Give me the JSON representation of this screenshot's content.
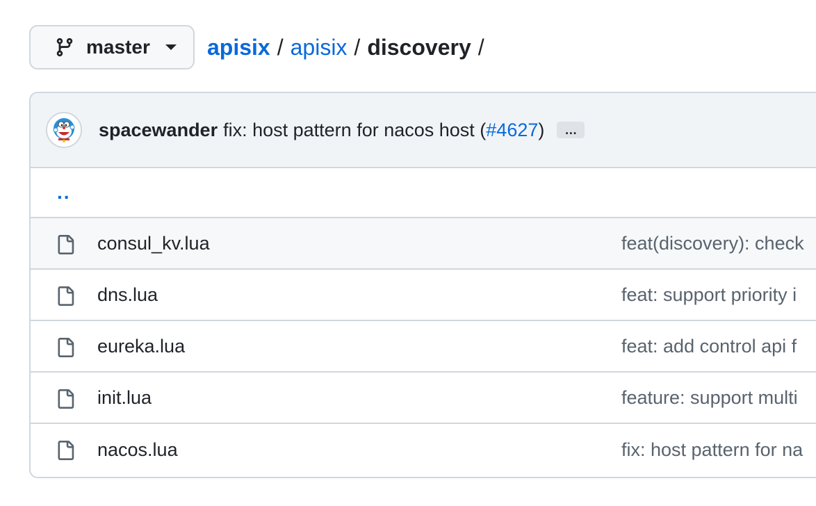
{
  "branch": {
    "name": "master",
    "icon": "git-branch-icon"
  },
  "breadcrumb": {
    "owner": "apisix",
    "repo": "apisix",
    "current": "discovery",
    "separator": "/"
  },
  "latest_commit": {
    "author": "spacewander",
    "message_prefix": "fix: host pattern for nacos host (",
    "pr": "#4627",
    "message_suffix": ")",
    "ellipsis": "…"
  },
  "parent_dir": "..",
  "files": [
    {
      "name": "consul_kv.lua",
      "commit": "feat(discovery): check"
    },
    {
      "name": "dns.lua",
      "commit": "feat: support priority i"
    },
    {
      "name": "eureka.lua",
      "commit": "feat: add control api f"
    },
    {
      "name": "init.lua",
      "commit": "feature: support multi"
    },
    {
      "name": "nacos.lua",
      "commit": "fix: host pattern for na"
    }
  ],
  "colors": {
    "link": "#0969da",
    "border": "#d0d7de",
    "header_bg": "#f1f4f7"
  }
}
